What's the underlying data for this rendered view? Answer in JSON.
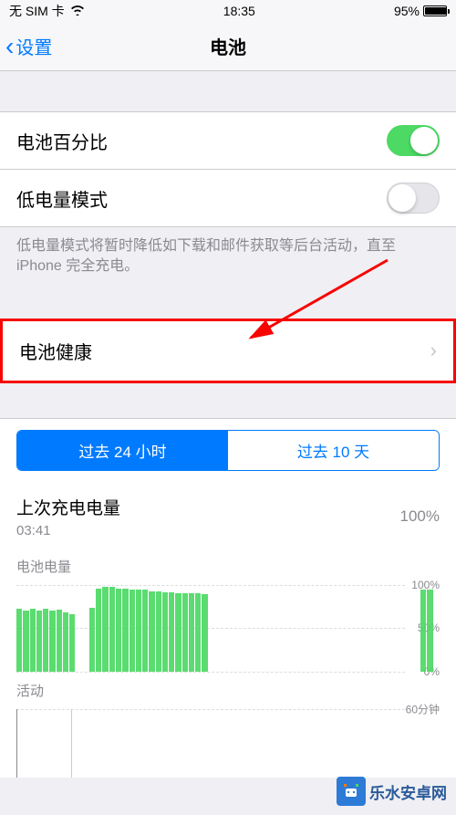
{
  "status_bar": {
    "carrier": "无 SIM 卡",
    "time": "18:35",
    "battery_pct": "95%"
  },
  "nav": {
    "back_label": "设置",
    "title": "电池"
  },
  "settings": {
    "battery_percentage": {
      "label": "电池百分比",
      "on": true
    },
    "low_power_mode": {
      "label": "低电量模式",
      "on": false
    },
    "low_power_footer": "低电量模式将暂时降低如下载和邮件获取等后台活动，直至 iPhone 完全充电。",
    "battery_health": {
      "label": "电池健康"
    }
  },
  "segmented": {
    "last24h": "过去 24 小时",
    "last10d": "过去 10 天",
    "active": 0
  },
  "last_charge": {
    "title": "上次充电电量",
    "time": "03:41",
    "pct": "100%"
  },
  "chart_data": [
    {
      "type": "bar",
      "title": "电池电量",
      "ylabel": "",
      "ylim": [
        0,
        100
      ],
      "y_ticks": [
        "100%",
        "50%",
        "0%"
      ],
      "values": [
        72,
        70,
        72,
        70,
        72,
        70,
        71,
        68,
        66,
        0,
        0,
        73,
        96,
        98,
        98,
        96,
        96,
        95,
        94,
        94,
        92,
        92,
        91,
        91,
        90,
        90,
        90,
        90,
        89,
        0,
        0,
        0,
        0,
        0,
        0,
        0,
        0,
        0,
        0,
        0,
        0,
        0,
        0,
        0,
        0,
        0,
        0,
        0,
        0,
        0,
        0,
        0,
        0,
        0,
        0,
        0,
        0,
        0,
        0,
        0,
        0,
        95,
        94,
        0
      ]
    },
    {
      "type": "bar",
      "title": "活动",
      "ylabel": "",
      "y_ticks": [
        "60分钟"
      ],
      "values": []
    }
  ],
  "watermark": "乐水安卓网"
}
